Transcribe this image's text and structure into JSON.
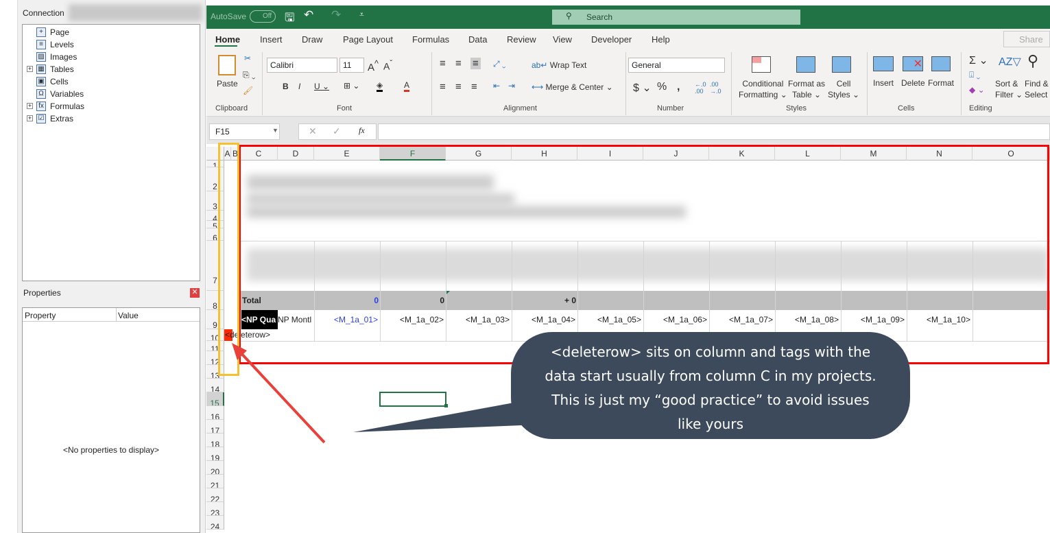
{
  "left_panel": {
    "connection_tab": "Connection",
    "tree_items": [
      {
        "label": "Page",
        "icon": "page-icon",
        "expandable": false
      },
      {
        "label": "Levels",
        "icon": "levels-icon",
        "expandable": false
      },
      {
        "label": "Images",
        "icon": "images-icon",
        "expandable": false
      },
      {
        "label": "Tables",
        "icon": "tables-icon",
        "expandable": true
      },
      {
        "label": "Cells",
        "icon": "cells-icon",
        "expandable": false
      },
      {
        "label": "Variables",
        "icon": "omega-icon",
        "expandable": false
      },
      {
        "label": "Formulas",
        "icon": "fx-icon",
        "expandable": true
      },
      {
        "label": "Extras",
        "icon": "extras-icon",
        "expandable": true
      }
    ],
    "properties_title": "Properties",
    "col_property": "Property",
    "col_value": "Value",
    "empty_text": "<No properties to display>"
  },
  "titlebar": {
    "autosave": "AutoSave",
    "toggle": "Off",
    "search": "Search"
  },
  "ribbon": {
    "tabs": [
      "Home",
      "Insert",
      "Draw",
      "Page Layout",
      "Formulas",
      "Data",
      "Review",
      "View",
      "Developer",
      "Help"
    ],
    "share": "Share",
    "paste": "Paste",
    "font_name": "Calibri",
    "font_size": "11",
    "wrap_text": "Wrap Text",
    "merge_center": "Merge & Center",
    "number_format": "General",
    "cond_format": [
      "Conditional",
      "Formatting"
    ],
    "format_table": [
      "Format as",
      "Table"
    ],
    "cell_styles": [
      "Cell",
      "Styles"
    ],
    "insert": "Insert",
    "delete": "Delete",
    "format": "Format",
    "sort_filter": [
      "Sort &",
      "Filter"
    ],
    "find_select": [
      "Find &",
      "Select"
    ],
    "groups": [
      "Clipboard",
      "Font",
      "Alignment",
      "Number",
      "Styles",
      "Cells",
      "Editing"
    ]
  },
  "formula_bar": {
    "name_box": "F15",
    "fx": "fx",
    "value": ""
  },
  "sheet": {
    "columns": [
      "A",
      "B",
      "C",
      "D",
      "E",
      "F",
      "G",
      "H",
      "I",
      "J",
      "K",
      "L",
      "M",
      "N",
      "O"
    ],
    "rows": [
      "1",
      "2",
      "3",
      "4",
      "5",
      "6",
      "7",
      "8",
      "9",
      "10",
      "11",
      "12",
      "13",
      "14",
      "15",
      "16",
      "17",
      "18",
      "19",
      "20",
      "21",
      "22",
      "23",
      "24"
    ],
    "selected_col": "F",
    "selected_row": "15",
    "total_label": "Total",
    "total_e": "0",
    "total_f": "0",
    "total_h": "+ 0",
    "c9": "<NP Qua",
    "d9": "NP Montl",
    "tags": [
      "<M_1a_01>",
      "<M_1a_02>",
      "<M_1a_03>",
      "<M_1a_04>",
      "<M_1a_05>",
      "<M_1a_06>",
      "<M_1a_07>",
      "<M_1a_08>",
      "<M_1a_09>",
      "<M_1a_10>"
    ],
    "a10": "<deleterow>"
  },
  "callout": {
    "text": [
      "<deleterow> sits on column and tags with the",
      "data start usually from column C in my projects.",
      "This is just my “good practice” to avoid issues",
      "like yours"
    ]
  },
  "colors": {
    "excel_green": "#217346",
    "callout_bg": "#3c4a5c",
    "highlight_red": "#ff0000",
    "highlight_yellow": "#f5c12e"
  }
}
